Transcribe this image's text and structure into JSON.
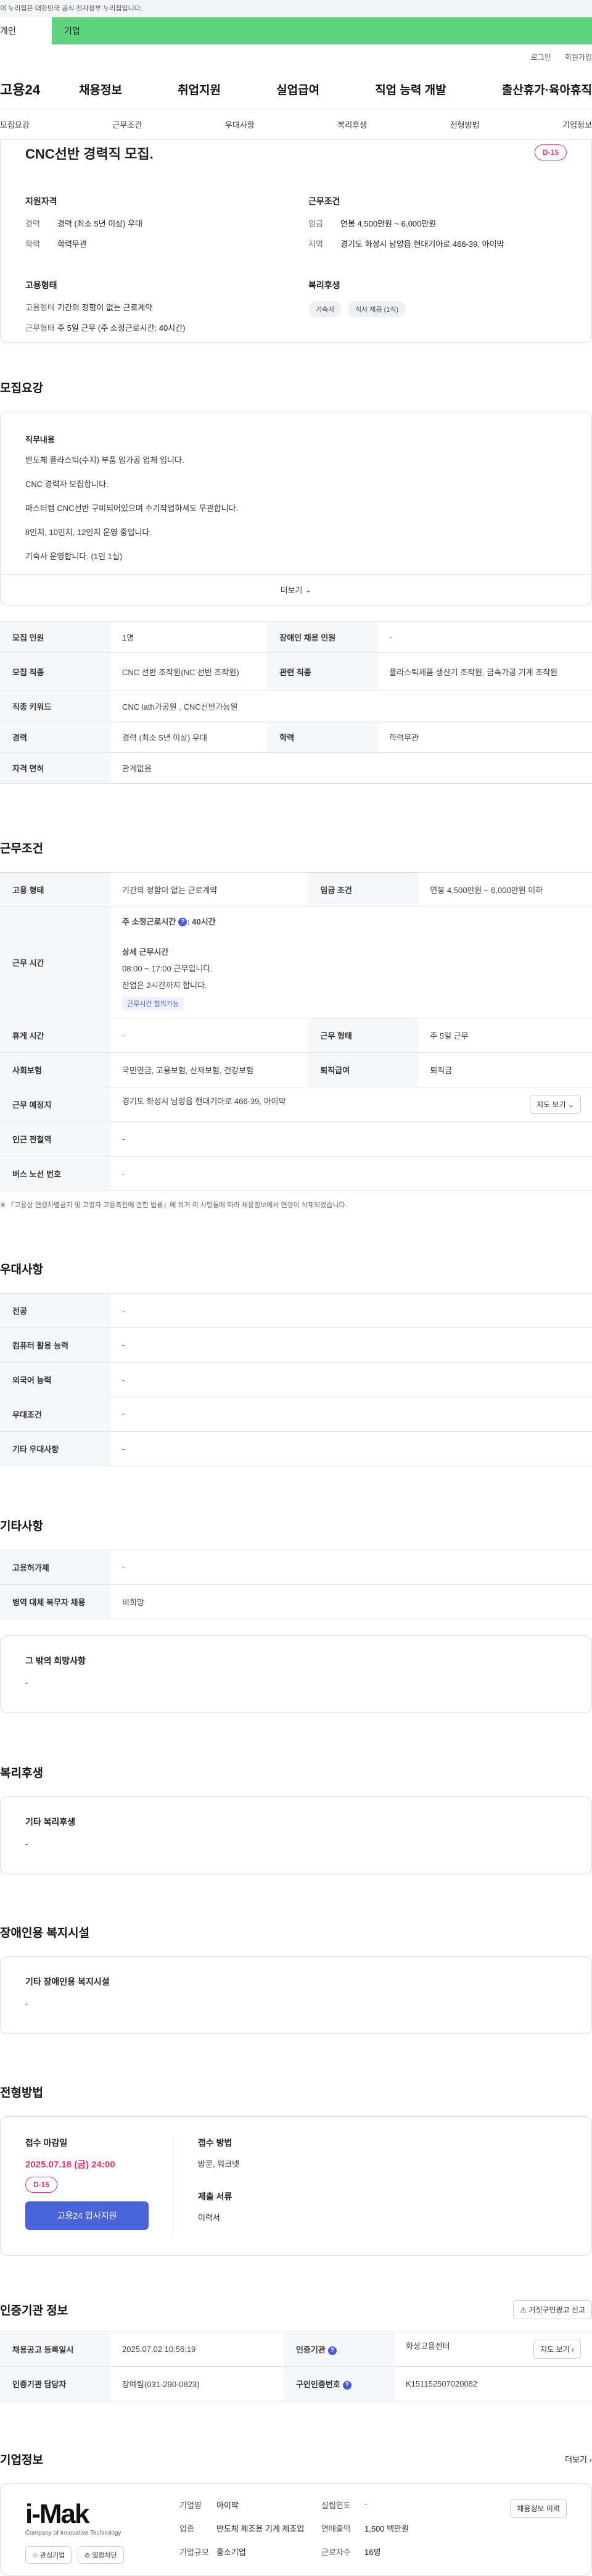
{
  "gov_banner": "이 누리집은 대한민국 공식 전자정부 누리집입니다.",
  "target_tabs": {
    "personal": "개인",
    "company": "기업"
  },
  "util": {
    "login": "로그인",
    "join": "회원가입"
  },
  "gnb": {
    "logo": "고용24",
    "menu": [
      "채용정보",
      "취업지원",
      "실업급여",
      "직업 능력 개발",
      "출산휴가·육아휴직"
    ]
  },
  "subnav": [
    "모집요강",
    "근무조건",
    "우대사항",
    "복리후생",
    "전형방법",
    "기업정보"
  ],
  "summary": {
    "title": "CNC선반 경력직 모집.",
    "dday": "D-15",
    "qualification": {
      "heading": "지원자격",
      "career_k": "경력",
      "career_v": "경력 (최소 5년 이상) 우대",
      "edu_k": "학력",
      "edu_v": "학력무관"
    },
    "conditions": {
      "heading": "근무조건",
      "wage_k": "임금",
      "wage_v": "연봉 4,500만원 ~ 6,000만원",
      "region_k": "지역",
      "region_v": "경기도 화성시 남양읍 현대기아로 466-39, 아이막"
    },
    "employment": {
      "heading": "고용형태",
      "type_k": "고용형태",
      "type_v": "기간의 정함이 없는 근로계약",
      "work_k": "근무형태",
      "work_v": "주 5일 근무 (주 소정근로시간: 40시간)"
    },
    "welfare": {
      "heading": "복리후생",
      "chips": [
        "기숙사",
        "식사 제공 (1식)"
      ]
    }
  },
  "recruit": {
    "title": "모집요강",
    "duty_heading": "직무내용",
    "duty_lines": [
      "반도체 플라스틱(수지) 부품 임가공 업체 입니다.",
      "CNC 경력자 모집합니다.",
      "마스터캠 CNC선반 구비되어있으며 수기작업하셔도 무관합니다.",
      "8인치, 10인치, 12인치 운영 중입니다.",
      "기숙사 운영합니다. (1인 1실)"
    ],
    "more": "더보기",
    "rows": {
      "count_k": "모집 인원",
      "count_v": "1명",
      "disabled_k": "장애인 채용 인원",
      "disabled_v": "-",
      "job_k": "모집 직종",
      "job_v": "CNC 선반 조작원(NC 선반 조작원)",
      "related_k": "관련 직종",
      "related_v": "플라스틱제품 생산기 조작원, 금속가공 기계 조작원",
      "keyword_k": "직종 키워드",
      "keyword_v": "CNC lath가공원 , CNC선반가능원",
      "career_k": "경력",
      "career_v": "경력 (최소 5년 이상) 우대",
      "edu_k": "학력",
      "edu_v": "학력무관",
      "license_k": "자격 면허",
      "license_v": "관계없음"
    }
  },
  "work": {
    "title": "근무조건",
    "type_k": "고용 형태",
    "type_v": "기간의 정함이 없는 근로계약",
    "wage_k": "임금 조건",
    "wage_v": "연봉 4,500만원 ~ 6,000만원 이하",
    "hours_k": "근무 시간",
    "hours_main": "주 소정근로시간",
    "hours_value": ": 40시간",
    "hours_detail_heading": "상세 근무시간",
    "hours_detail_1": "08:00 ~ 17:00 근무입니다.",
    "hours_detail_2": "잔업은 2시간까지 합니다.",
    "hours_tag": "근무시간 협의가능",
    "rest_k": "휴게 시간",
    "rest_v": "-",
    "shift_k": "근무 형태",
    "shift_v": "주 5일 근무",
    "insurance_k": "사회보험",
    "insurance_v": "국민연금, 고용보험, 산재보험, 건강보험",
    "severance_k": "퇴직급여",
    "severance_v": "퇴직금",
    "place_k": "근무 예정지",
    "place_v": "경기도 화성시 남양읍 현대기아로 466-39, 아이막",
    "map_btn": "지도 보기",
    "station_k": "인근 전철역",
    "station_v": "-",
    "bus_k": "버스 노선 번호",
    "bus_v": "-",
    "note": "『고용상 연령차별금지 및 고령자 고용촉진에 관한 법률』에 의거 이 사항들에 따라 채용정보에서 연령이 삭제되었습니다."
  },
  "preference": {
    "title": "우대사항",
    "major_k": "전공",
    "major_v": "-",
    "computer_k": "컴퓨터 활용 능력",
    "computer_v": "-",
    "language_k": "외국어 능력",
    "language_v": "-",
    "condition_k": "우대조건",
    "condition_v": "-",
    "etc_k": "기타 우대사항",
    "etc_v": "-"
  },
  "others": {
    "title": "기타사항",
    "facility_k": "고용허가제",
    "facility_v": "-",
    "military_k": "병역 대체 복무자 채용",
    "military_v": "비희망",
    "request_heading": "그 밖의 희망사항",
    "request_v": "-"
  },
  "welfare": {
    "title": "복리후생",
    "heading": "기타 복리후생",
    "value": "-"
  },
  "disability": {
    "title": "장애인용 복지시설",
    "heading": "기타 장애인용 복지시설",
    "value": "-"
  },
  "apply": {
    "title": "전형방법",
    "deadline_heading": "접수 마감일",
    "deadline": "2025.07.18 (금) 24:00",
    "dday": "D-15",
    "apply_btn": "고용24 입사지원",
    "method_heading": "접수 방법",
    "method_v": "방문, 워크넷",
    "docs_heading": "제출 서류",
    "docs_v": "이력서"
  },
  "cert": {
    "title": "인증기관 정보",
    "report_btn": "거짓구인광고 신고",
    "reg_k": "채용공고 등록일시",
    "reg_v": "2025.07.02 10:56:19",
    "agency_k": "인증기관",
    "agency_v": "화성고용센터",
    "map_btn": "지도 보기",
    "manager_k": "인증기관 담당자",
    "manager_v": "장예림(031-290-0823)",
    "number_k": "구인인증번호",
    "number_v": "K151152507020082"
  },
  "company": {
    "title": "기업정보",
    "more": "더보기",
    "logo_text": "i-Mak",
    "logo_sub": "Company of Innovative Technology",
    "fav_btn": "관심기업",
    "block_btn": "열람차단",
    "name_k": "기업명",
    "name_v": "아이막",
    "founded_k": "설립연도",
    "founded_v": "-",
    "jobs_btn": "채용정보 이력",
    "industry_k": "업종",
    "industry_v": "반도체 제조용 기계 제조업",
    "sales_k": "연매출액",
    "sales_v": "1,500 백만원",
    "size_k": "기업규모",
    "size_v": "중소기업",
    "employees_k": "근로자수",
    "employees_v": "16명"
  }
}
